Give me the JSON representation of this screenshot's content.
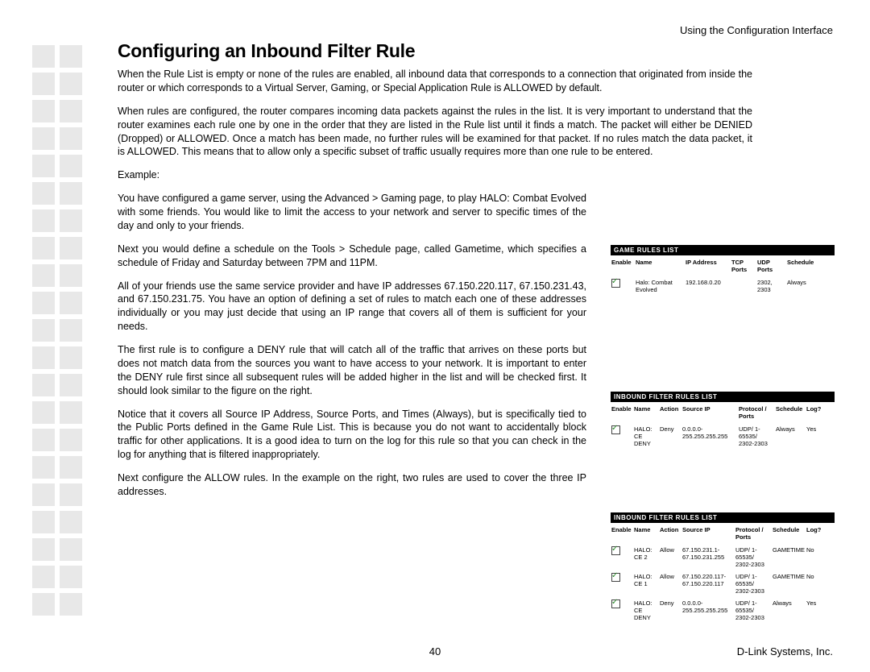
{
  "header": {
    "right": "Using the Configuration Interface"
  },
  "heading": "Configuring an Inbound Filter Rule",
  "paragraphs": {
    "p1": "When the Rule List is empty or none of the rules are enabled, all inbound data that corresponds to a connection that originated from inside the router or which corresponds to a Virtual Server, Gaming, or Special Application Rule is ALLOWED by default.",
    "p2": "When rules are configured, the router compares incoming data packets against the rules in the list. It is very important to understand that the router examines each rule one by one in the order that they are listed in the Rule list until it finds a match. The packet will either be DENIED (Dropped) or ALLOWED. Once a match has been made, no further rules will be examined for that packet. If no rules match the data packet, it is ALLOWED. This means that to allow only a specific subset of traffic usually requires more than one rule to be entered.",
    "p3": "Example:",
    "p4": "You have configured a game server, using the Advanced > Gaming page, to play HALO: Combat Evolved with some friends. You would like to limit the access to your network and server to specific times of the day and only to your friends.",
    "p5": "Next you would define a schedule on the Tools > Schedule page, called Gametime, which specifies a schedule of Friday and Saturday between 7PM and 11PM.",
    "p6": "All of your friends use the same service provider and have IP addresses 67.150.220.117, 67.150.231.43, and 67.150.231.75. You have an option of defining a set of rules to match each one of these addresses individually or you may just decide that using an IP range that covers all of them is sufficient for your needs.",
    "p7": "The first rule is to configure a DENY rule that will catch all of the traffic that arrives on these ports but does not match data from the sources you want to have access to your network. It is important to enter the DENY rule first since all subsequent rules will be added higher in the list and will be checked first. It should look similar to the figure on the right.",
    "p8": "Notice that it covers all Source IP Address, Source Ports, and Times (Always), but is specifically tied to the Public Ports defined in the Game Rule List. This is because you do not want to accidentally block traffic for other applications. It is a good idea to turn on the log for this rule so that you can check in the log for anything that is filtered inappropriately.",
    "p9": "Next configure the ALLOW rules. In the example on the right, two rules are used to cover the three IP addresses."
  },
  "panel1": {
    "title": "GAME RULES LIST",
    "headers": [
      "Enable",
      "Name",
      "IP Address",
      "TCP Ports",
      "UDP Ports",
      "Schedule"
    ],
    "rows": [
      {
        "name": "Halo: Combat Evolved",
        "ip": "192.168.0.20",
        "tcp": "",
        "udp": "2302, 2303",
        "schedule": "Always"
      }
    ]
  },
  "panel2": {
    "title": "INBOUND FILTER RULES LIST",
    "headers": [
      "Enable",
      "Name",
      "Action",
      "Source IP",
      "Protocol / Ports",
      "Schedule",
      "Log?"
    ],
    "rows": [
      {
        "name": "HALO: CE DENY",
        "action": "Deny",
        "source": "0.0.0.0-255.255.255.255",
        "proto": "UDP/ 1-65535/ 2302-2303",
        "schedule": "Always",
        "log": "Yes"
      }
    ]
  },
  "panel3": {
    "title": "INBOUND FILTER RULES LIST",
    "headers": [
      "Enable",
      "Name",
      "Action",
      "Source IP",
      "Protocol / Ports",
      "Schedule",
      "Log?"
    ],
    "rows": [
      {
        "name": "HALO: CE 2",
        "action": "Allow",
        "source": "67.150.231.1-67.150.231.255",
        "proto": "UDP/ 1-65535/ 2302-2303",
        "schedule": "GAMETIME",
        "log": "No"
      },
      {
        "name": "HALO: CE 1",
        "action": "Allow",
        "source": "67.150.220.117-67.150.220.117",
        "proto": "UDP/ 1-65535/ 2302-2303",
        "schedule": "GAMETIME",
        "log": "No"
      },
      {
        "name": "HALO: CE DENY",
        "action": "Deny",
        "source": "0.0.0.0-255.255.255.255",
        "proto": "UDP/ 1-65535/ 2302-2303",
        "schedule": "Always",
        "log": "Yes"
      }
    ]
  },
  "footer": {
    "page": "40",
    "brand": "D-Link Systems, Inc."
  }
}
